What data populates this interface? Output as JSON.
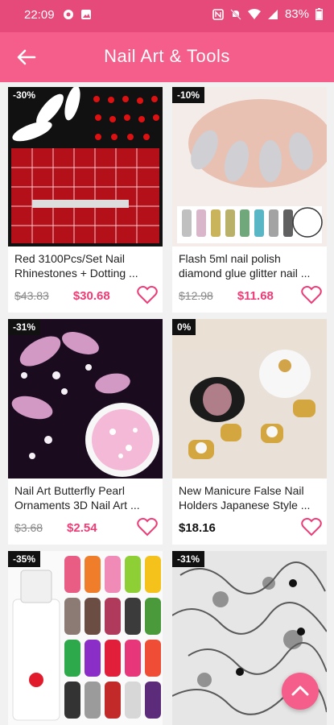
{
  "status": {
    "time": "22:09",
    "battery": "83%"
  },
  "header": {
    "title": "Nail Art & Tools"
  },
  "colors": {
    "accent": "#f55e8b",
    "status_bar": "#e64a7a",
    "price": "#ee3b75"
  },
  "products": [
    {
      "discount": "-30%",
      "name": "Red 3100Pcs/Set Nail Rhinestones + Dotting ...",
      "old_price": "$43.83",
      "price": "$30.68"
    },
    {
      "discount": "-10%",
      "name": "Flash 5ml nail polish diamond glue glitter nail ...",
      "old_price": "$12.98",
      "price": "$11.68"
    },
    {
      "discount": "-31%",
      "name": "Nail Art Butterfly Pearl Ornaments 3D Nail Art ...",
      "old_price": "$3.68",
      "price": "$2.54"
    },
    {
      "discount": "0%",
      "name": "New Manicure False Nail Holders Japanese Style ...",
      "old_price": "",
      "price": "$18.16"
    },
    {
      "discount": "-35%",
      "name": "",
      "old_price": "",
      "price": ""
    },
    {
      "discount": "-31%",
      "name": "",
      "old_price": "",
      "price": ""
    }
  ],
  "icons": {
    "back": "arrow-left-icon",
    "wishlist": "heart-outline-icon",
    "scroll_top": "chevron-up-icon"
  }
}
